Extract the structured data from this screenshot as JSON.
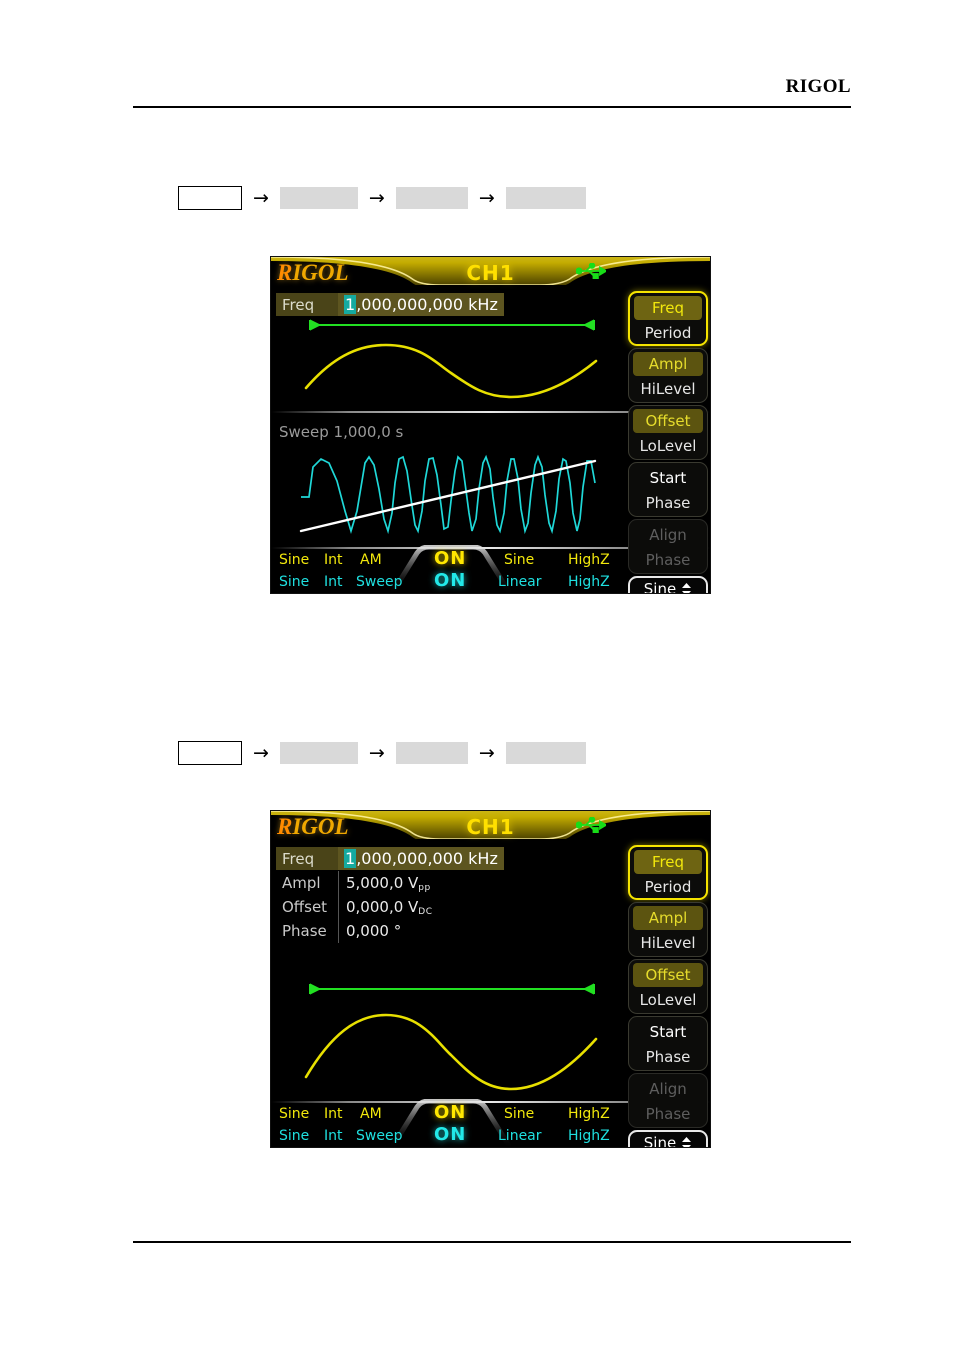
{
  "page": {
    "header_brand": "RIGOL",
    "breadcrumb_arrow": "→"
  },
  "breadcrumbs": [
    {
      "name": "breadcrumb-row-1",
      "key_label": "",
      "steps": [
        "",
        "",
        ""
      ]
    },
    {
      "name": "breadcrumb-row-2",
      "key_label": "",
      "steps": [
        "",
        "",
        ""
      ]
    }
  ],
  "colors": {
    "brand_orange": "#ff8c00",
    "brand_gold": "#f0a800",
    "channel_yellow": "#ffe000",
    "cyan": "#1fe0e0",
    "green": "#00e000",
    "highlight_cursor": "#15aaa0",
    "waveform_yellow": "#e8e000",
    "sweep_cyan": "#1fd8d8",
    "ramp_white": "#ffffff",
    "select_border": "#f5e400",
    "dim_gray": "#5e5e5e"
  },
  "screens": [
    {
      "name": "sweep-screen",
      "brand": "RIGOL",
      "brand_first_letter": "R",
      "brand_rest": "IGOL",
      "channel": "CH1",
      "usb_icon": "usb-icon",
      "freq": {
        "label": "Freq",
        "cursor_digit": "1",
        "value_rest": ",000,000,000",
        "unit": "kHz",
        "full_value": "1,000,000,000 kHz"
      },
      "sweep": {
        "label": "Sweep",
        "time": "1,000,0",
        "unit": "s",
        "full": "Sweep 1,000,0 s"
      },
      "status_bar": {
        "row1": [
          "Sine",
          "Int",
          "AM",
          "ON",
          "Sine",
          "HighZ"
        ],
        "row2": [
          "Sine",
          "Int",
          "Sweep",
          "ON",
          "Linear",
          "HighZ"
        ]
      },
      "softkeys": [
        {
          "name": "softkey-freq-period",
          "top": "Freq",
          "bottom": "Period",
          "selected": true,
          "dim": false,
          "top_highlight": "hl"
        },
        {
          "name": "softkey-ampl-hilevel",
          "top": "Ampl",
          "bottom": "HiLevel",
          "selected": false,
          "dim": false,
          "top_highlight": "hl2"
        },
        {
          "name": "softkey-offset-lolevel",
          "top": "Offset",
          "bottom": "LoLevel",
          "selected": false,
          "dim": false,
          "top_highlight": "hl2"
        },
        {
          "name": "softkey-start-phase",
          "top": "Start",
          "bottom": "Phase",
          "selected": false,
          "dim": false,
          "top_highlight": ""
        },
        {
          "name": "softkey-align-phase",
          "top": "Align",
          "bottom": "Phase",
          "selected": false,
          "dim": true,
          "top_highlight": ""
        }
      ],
      "waveform_dropdown": {
        "label": "Sine",
        "name": "waveform-select"
      }
    },
    {
      "name": "sine-parameter-screen",
      "brand": "RIGOL",
      "brand_first_letter": "R",
      "brand_rest": "IGOL",
      "channel": "CH1",
      "usb_icon": "usb-icon",
      "freq": {
        "label": "Freq",
        "cursor_digit": "1",
        "value_rest": ",000,000,000",
        "unit": "kHz",
        "full_value": "1,000,000,000 kHz"
      },
      "parameters": [
        {
          "key": "Ampl",
          "value": "5,000,0 Vpp",
          "value_main": "5,000,0 V",
          "value_sub": "pp"
        },
        {
          "key": "Offset",
          "value": "0,000,0 Vdc",
          "value_main": "0,000,0 V",
          "value_sub": "DC"
        },
        {
          "key": "Phase",
          "value": "0,000 °",
          "value_main": "0,000 °",
          "value_sub": ""
        }
      ],
      "status_bar": {
        "row1": [
          "Sine",
          "Int",
          "AM",
          "ON",
          "Sine",
          "HighZ"
        ],
        "row2": [
          "Sine",
          "Int",
          "Sweep",
          "ON",
          "Linear",
          "HighZ"
        ]
      },
      "softkeys": [
        {
          "name": "softkey-freq-period",
          "top": "Freq",
          "bottom": "Period",
          "selected": true,
          "dim": false,
          "top_highlight": "hl"
        },
        {
          "name": "softkey-ampl-hilevel",
          "top": "Ampl",
          "bottom": "HiLevel",
          "selected": false,
          "dim": false,
          "top_highlight": "hl2"
        },
        {
          "name": "softkey-offset-lolevel",
          "top": "Offset",
          "bottom": "LoLevel",
          "selected": false,
          "dim": false,
          "top_highlight": "hl2"
        },
        {
          "name": "softkey-start-phase",
          "top": "Start",
          "bottom": "Phase",
          "selected": false,
          "dim": false,
          "top_highlight": ""
        },
        {
          "name": "softkey-align-phase",
          "top": "Align",
          "bottom": "Phase",
          "selected": false,
          "dim": true,
          "top_highlight": ""
        }
      ],
      "waveform_dropdown": {
        "label": "Sine",
        "name": "waveform-select"
      }
    }
  ]
}
